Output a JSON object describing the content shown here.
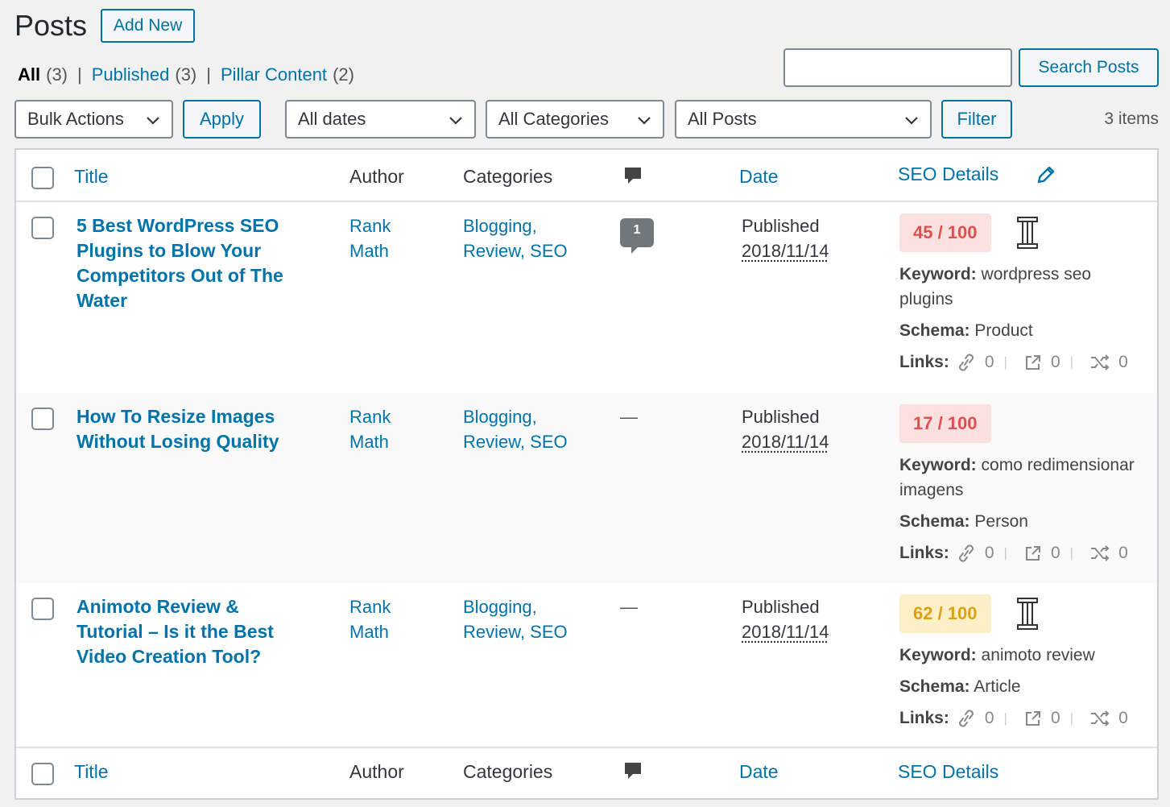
{
  "page": {
    "title": "Posts",
    "add_new": "Add New"
  },
  "views": {
    "all_label": "All",
    "all_count": "(3)",
    "published_label": "Published",
    "published_count": "(3)",
    "pillar_label": "Pillar Content",
    "pillar_count": "(2)",
    "separator": "|"
  },
  "search": {
    "value": "",
    "button": "Search Posts"
  },
  "filters": {
    "bulk_actions": "Bulk Actions",
    "apply": "Apply",
    "dates": "All dates",
    "categories": "All Categories",
    "posts": "All Posts",
    "filter": "Filter",
    "items": "3 items"
  },
  "columns": {
    "title": "Title",
    "author": "Author",
    "categories": "Categories",
    "date": "Date",
    "seo": "SEO Details"
  },
  "rows": [
    {
      "title": "5 Best WordPress SEO Plugins to Blow Your Competitors Out of The Water",
      "author": "Rank Math",
      "categories": "Blogging, Review, SEO",
      "comments": "1",
      "status": "Published",
      "date": "2018/11/14",
      "score": "45 / 100",
      "keyword_label": "Keyword:",
      "keyword": "wordpress seo plugins",
      "schema_label": "Schema:",
      "schema": "Product",
      "links_label": "Links:",
      "internal": "0",
      "external": "0",
      "incoming": "0"
    },
    {
      "title": "How To Resize Images Without Losing Quality",
      "author": "Rank Math",
      "categories": "Blogging, Review, SEO",
      "comments": "—",
      "status": "Published",
      "date": "2018/11/14",
      "score": "17 / 100",
      "keyword_label": "Keyword:",
      "keyword": "como redimensionar imagens",
      "schema_label": "Schema:",
      "schema": "Person",
      "links_label": "Links:",
      "internal": "0",
      "external": "0",
      "incoming": "0"
    },
    {
      "title": "Animoto Review & Tutorial – Is it the Best Video Creation Tool?",
      "author": "Rank Math",
      "categories": "Blogging, Review, SEO",
      "comments": "—",
      "status": "Published",
      "date": "2018/11/14",
      "score": "62 / 100",
      "keyword_label": "Keyword:",
      "keyword": "animoto review",
      "schema_label": "Schema:",
      "schema": "Article",
      "links_label": "Links:",
      "internal": "0",
      "external": "0",
      "incoming": "0"
    }
  ],
  "colors": {
    "accent": "#0073aa",
    "bad": "#e04f4f",
    "ok": "#e0a014"
  }
}
